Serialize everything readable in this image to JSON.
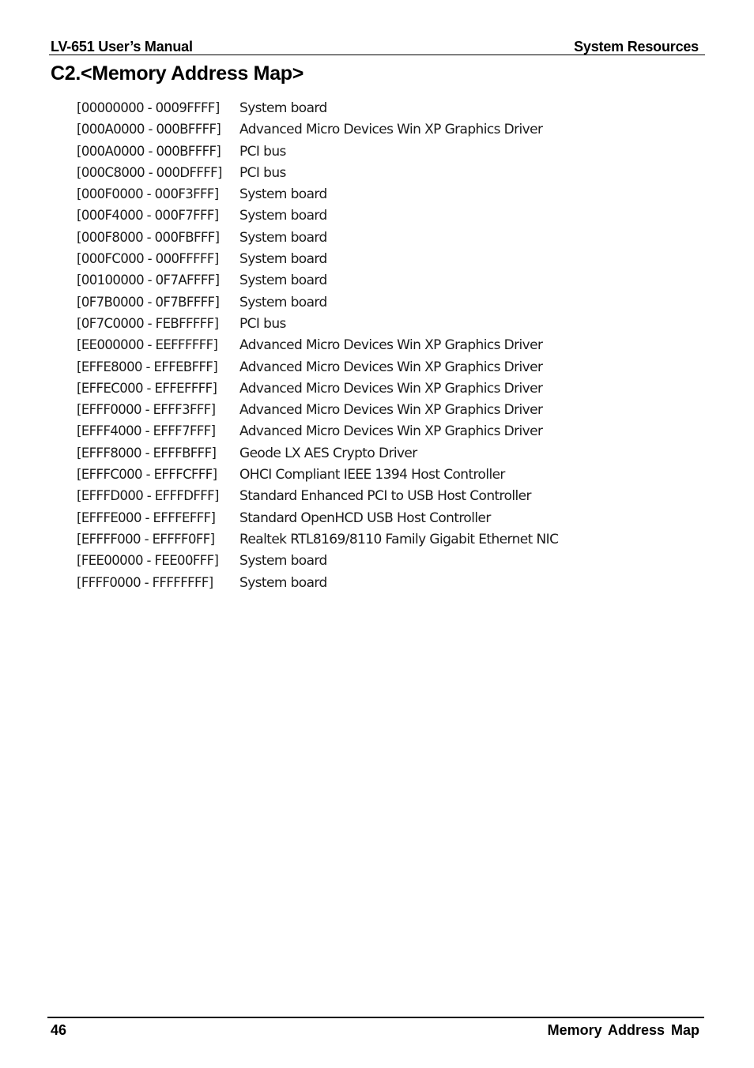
{
  "header": {
    "left": "LV-651 User’s Manual",
    "right": "System Resources"
  },
  "title": "C2.<Memory Address Map>",
  "memory_map": [
    {
      "range": "[00000000 - 0009FFFF]",
      "device": "System board"
    },
    {
      "range": "[000A0000 - 000BFFFF]",
      "device": "Advanced Micro Devices Win XP Graphics Driver"
    },
    {
      "range": "[000A0000 - 000BFFFF]",
      "device": "PCI bus"
    },
    {
      "range": "[000C8000 - 000DFFFF]",
      "device": "PCI bus"
    },
    {
      "range": "[000F0000 - 000F3FFF]",
      "device": "System board"
    },
    {
      "range": "[000F4000 - 000F7FFF]",
      "device": "System board"
    },
    {
      "range": "[000F8000 - 000FBFFF]",
      "device": "System board"
    },
    {
      "range": "[000FC000 - 000FFFFF]",
      "device": "System board"
    },
    {
      "range": "[00100000 - 0F7AFFFF]",
      "device": "System board"
    },
    {
      "range": "[0F7B0000 - 0F7BFFFF]",
      "device": "System board"
    },
    {
      "range": "[0F7C0000 - FEBFFFFF]",
      "device": "PCI bus"
    },
    {
      "range": "[EE000000 - EEFFFFFF]",
      "device": "Advanced Micro Devices Win XP Graphics Driver"
    },
    {
      "range": "[EFFE8000 - EFFEBFFF]",
      "device": "Advanced Micro Devices Win XP Graphics Driver"
    },
    {
      "range": "[EFFEC000 - EFFEFFFF]",
      "device": "Advanced Micro Devices Win XP Graphics Driver"
    },
    {
      "range": "[EFFF0000 - EFFF3FFF]",
      "device": "Advanced Micro Devices Win XP Graphics Driver"
    },
    {
      "range": "[EFFF4000 - EFFF7FFF]",
      "device": "Advanced Micro Devices Win XP Graphics Driver"
    },
    {
      "range": "[EFFF8000 - EFFFBFFF]",
      "device": "Geode LX AES Crypto Driver"
    },
    {
      "range": "[EFFFC000 - EFFFCFFF]",
      "device": "OHCI Compliant IEEE 1394 Host Controller"
    },
    {
      "range": "[EFFFD000 - EFFFDFFF]",
      "device": "Standard Enhanced PCI to USB Host Controller"
    },
    {
      "range": "[EFFFE000 - EFFFEFFF]",
      "device": "Standard OpenHCD USB Host Controller"
    },
    {
      "range": "[EFFFF000 - EFFFF0FF]",
      "device": "Realtek RTL8169/8110 Family Gigabit Ethernet NIC"
    },
    {
      "range": "[FEE00000 - FEE00FFF]",
      "device": "System board"
    },
    {
      "range": "[FFFF0000 - FFFFFFFF]",
      "device": "System board"
    }
  ],
  "footer": {
    "page_number": "46",
    "section": "Memory Address Map"
  }
}
